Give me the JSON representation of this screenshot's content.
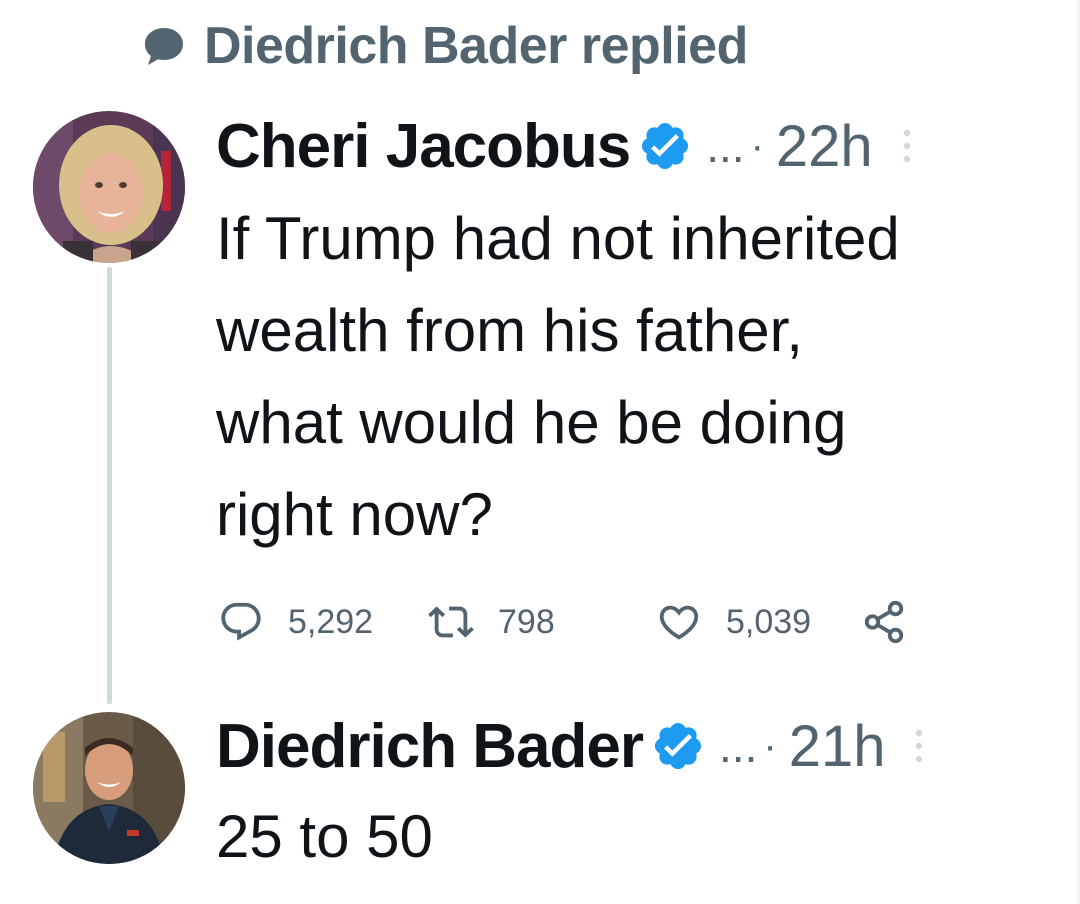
{
  "reply_context": {
    "text": "Diedrich Bader replied",
    "icon": "speech-bubble-icon"
  },
  "tweets": [
    {
      "author": "Cheri Jacobus",
      "verified": true,
      "truncation": "...",
      "separator": "·",
      "time": "22h",
      "text": "If Trump had not inherited\nwealth from his father,\nwhat would he be doing\nright now?",
      "stats": {
        "replies": "5,292",
        "retweets": "798",
        "likes": "5,039"
      }
    },
    {
      "author": "Diedrich Bader",
      "verified": true,
      "truncation": "...",
      "separator": "·",
      "time": "21h",
      "text": "25 to 50"
    }
  ],
  "colors": {
    "text_primary": "#0f1419",
    "text_secondary": "#536471",
    "verified_blue": "#1d9bf0",
    "thread_line": "#cfd9de"
  },
  "icons": {
    "reply": "reply-icon",
    "retweet": "retweet-icon",
    "like": "heart-icon",
    "share": "share-icon",
    "verified": "verified-badge-icon",
    "more": "more-dots-icon"
  }
}
